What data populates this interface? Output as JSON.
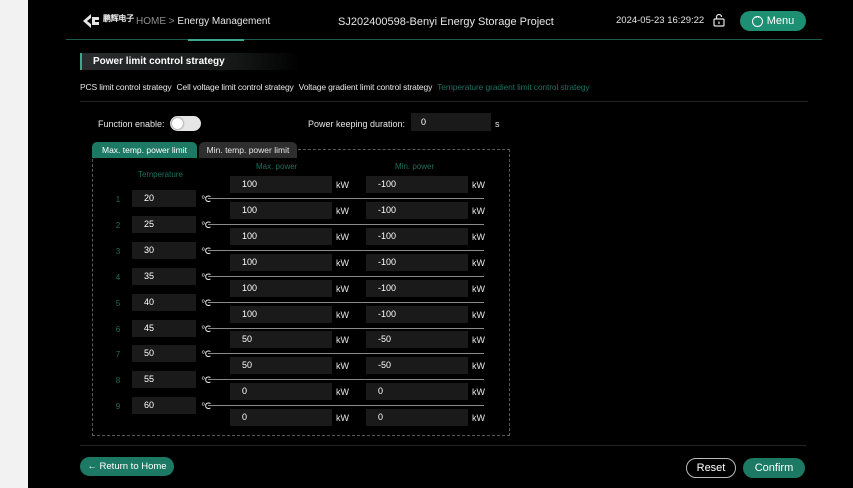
{
  "header": {
    "logo_text": "鹏辉电子",
    "breadcrumb_home": "HOME",
    "breadcrumb_sep": ">",
    "breadcrumb_current": "Energy Management",
    "project": "SJ202400598-Benyi Energy Storage Project",
    "datetime": "2024-05-23 16:29:22",
    "menu_label": "Menu"
  },
  "section_title": "Power limit control strategy",
  "strategy_tabs": [
    "PCS limit control strategy",
    "Cell voltage limit control strategy",
    "Voltage gradient limit control strategy",
    "Temperature gradient limit control strategy"
  ],
  "active_strategy_tab": 3,
  "function_enable": {
    "label": "Function enable:",
    "on": false
  },
  "duration": {
    "label": "Power keeping duration:",
    "value": "0",
    "unit": "s"
  },
  "sub_tabs": {
    "max": "Max. temp. power limit",
    "min": "Min. temp. power limit",
    "active": "max"
  },
  "table": {
    "headers": {
      "temperature": "Temperature",
      "max_power": "Max. power",
      "min_power": "Min. power"
    },
    "temp_unit": "℃",
    "power_unit": "kW",
    "temps": [
      {
        "index": "1",
        "value": "20"
      },
      {
        "index": "2",
        "value": "25"
      },
      {
        "index": "3",
        "value": "30"
      },
      {
        "index": "4",
        "value": "35"
      },
      {
        "index": "5",
        "value": "40"
      },
      {
        "index": "6",
        "value": "45"
      },
      {
        "index": "7",
        "value": "50"
      },
      {
        "index": "8",
        "value": "55"
      },
      {
        "index": "9",
        "value": "60"
      }
    ],
    "powers": [
      {
        "max": "100",
        "min": "-100"
      },
      {
        "max": "100",
        "min": "-100"
      },
      {
        "max": "100",
        "min": "-100"
      },
      {
        "max": "100",
        "min": "-100"
      },
      {
        "max": "100",
        "min": "-100"
      },
      {
        "max": "100",
        "min": "-100"
      },
      {
        "max": "50",
        "min": "-50"
      },
      {
        "max": "50",
        "min": "-50"
      },
      {
        "max": "0",
        "min": "0"
      },
      {
        "max": "0",
        "min": "0"
      }
    ]
  },
  "footer": {
    "home": "Return to Home",
    "reset": "Reset",
    "confirm": "Confirm"
  },
  "colors": {
    "accent": "#1c7a64",
    "inactive_tab": "#1c6f5d",
    "background": "#000000"
  }
}
